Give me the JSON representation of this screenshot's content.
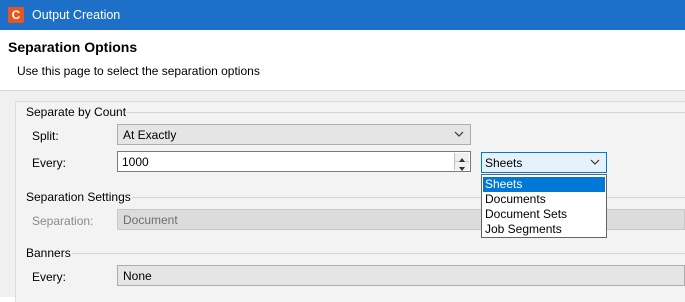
{
  "window": {
    "title": "Output Creation",
    "icon_letter": "C"
  },
  "header": {
    "title": "Separation Options",
    "description": "Use this page to select the separation options"
  },
  "separate_by_count": {
    "group_title": "Separate by Count",
    "split_label": "Split:",
    "split_value": "At Exactly",
    "every_label": "Every:",
    "every_value": "1000",
    "unit_value": "Sheets",
    "unit_options": [
      "Sheets",
      "Documents",
      "Document Sets",
      "Job Segments"
    ],
    "unit_selected_index": 0
  },
  "separation_settings": {
    "group_title": "Separation Settings",
    "separation_label": "Separation:",
    "separation_value": "Document"
  },
  "banners": {
    "group_title": "Banners",
    "every_label": "Every:",
    "every_value": "None"
  },
  "colors": {
    "titlebar": "#1e6fc8",
    "selection": "#0078d7",
    "app_icon": "#e8561f"
  }
}
